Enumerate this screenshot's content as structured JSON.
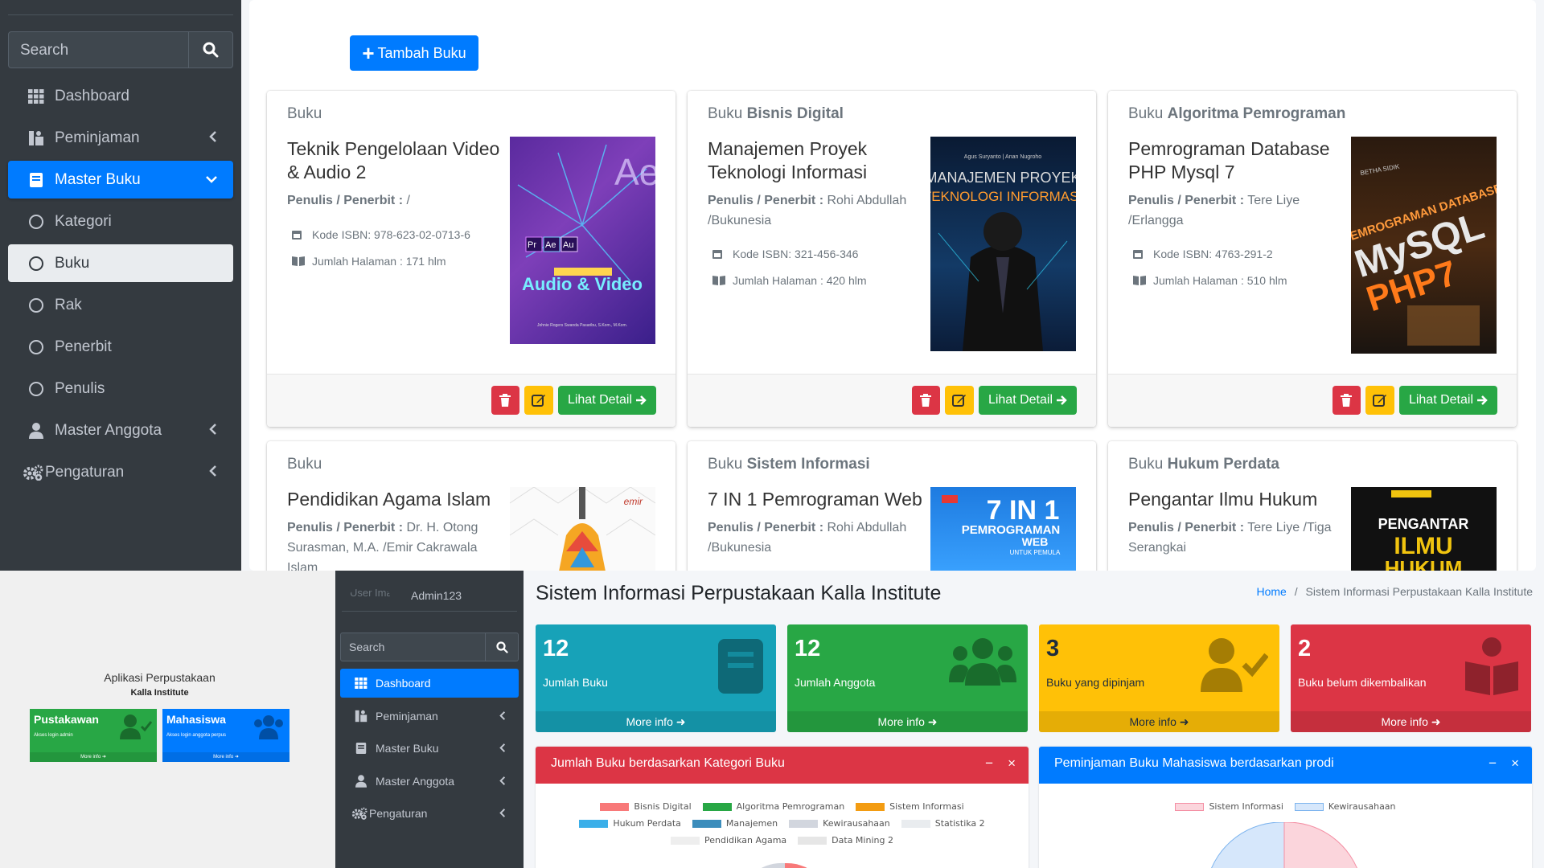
{
  "top": {
    "search_placeholder": "Search",
    "sidebar": [
      {
        "label": "Dashboard"
      },
      {
        "label": "Peminjaman"
      },
      {
        "label": "Master Buku"
      },
      {
        "label": "Kategori"
      },
      {
        "label": "Buku"
      },
      {
        "label": "Rak"
      },
      {
        "label": "Penerbit"
      },
      {
        "label": "Penulis"
      },
      {
        "label": "Master Anggota"
      },
      {
        "label": "Pengaturan"
      }
    ],
    "add_button": "Tambah Buku",
    "author_label": "Penulis / Penerbit :",
    "detail_label": "Lihat Detail",
    "cards": [
      {
        "prefix": "Buku",
        "category": "",
        "title": "Teknik Pengelolaan Video & Audio 2",
        "author": " /",
        "isbn": "Kode ISBN: 978-623-02-0713-6",
        "pages": "Jumlah Halaman : 171 hlm",
        "cover_text": "Audio & Video"
      },
      {
        "prefix": "Buku",
        "category": "Bisnis Digital",
        "title": "Manajemen Proyek Teknologi Informasi",
        "author": " Rohi Abdullah /Bukunesia",
        "isbn": "Kode ISBN: 321-456-346",
        "pages": "Jumlah Halaman : 420 hlm",
        "cover_text": "MANAJEMEN PROYEK TEKNOLOGI INFORMASI"
      },
      {
        "prefix": "Buku",
        "category": "Algoritma Pemrograman",
        "title": "Pemrograman Database PHP Mysql 7",
        "author": " Tere Liye /Erlangga",
        "isbn": "Kode ISBN: 4763-291-2",
        "pages": "Jumlah Halaman : 510 hlm",
        "cover_text": "MySQL PHP7"
      },
      {
        "prefix": "Buku",
        "category": "",
        "title": "Pendidikan Agama Islam",
        "author": " Dr. H. Otong Surasman, M.A. /Emir Cakrawala Islam",
        "cover_text": "emir"
      },
      {
        "prefix": "Buku",
        "category": "Sistem Informasi",
        "title": "7 IN 1 Pemrograman Web",
        "author": " Rohi Abdullah /Bukunesia",
        "cover_text": "7 IN 1 PEMROGRAMAN WEB"
      },
      {
        "prefix": "Buku",
        "category": "Hukum Perdata",
        "title": "Pengantar Ilmu Hukum",
        "author": " Tere Liye /Tiga Serangkai",
        "cover_text": "PENGANTAR ILMU HUKUM"
      }
    ]
  },
  "login": {
    "app_title": "Aplikasi Perpustakaan",
    "app_sub": "Kalla Institute",
    "boxes": [
      {
        "title": "Pustakawan",
        "desc": "Akses login admin",
        "more": "More info",
        "color": "#28a745"
      },
      {
        "title": "Mahasiswa",
        "desc": "Akses login anggota perpus",
        "more": "More info",
        "color": "#007bff"
      }
    ]
  },
  "dash": {
    "user_image_alt": "User Image",
    "username": "Admin123",
    "search_placeholder": "Search",
    "sidebar": [
      {
        "label": "Dashboard"
      },
      {
        "label": "Peminjaman"
      },
      {
        "label": "Master Buku"
      },
      {
        "label": "Master Anggota"
      },
      {
        "label": "Pengaturan"
      }
    ],
    "page_title": "Sistem Informasi Perpustakaan Kalla Institute",
    "breadcrumb_home": "Home",
    "breadcrumb_sep": "/",
    "breadcrumb_current": "Sistem Informasi Perpustakaan Kalla Institute",
    "stats": [
      {
        "num": "12",
        "label": "Jumlah Buku",
        "more": "More info",
        "color": "#17a2b8"
      },
      {
        "num": "12",
        "label": "Jumlah Anggota",
        "more": "More info",
        "color": "#28a745"
      },
      {
        "num": "3",
        "label": "Buku yang dipinjam",
        "more": "More info",
        "color": "#ffc107"
      },
      {
        "num": "2",
        "label": "Buku belum dikembalikan",
        "more": "More info",
        "color": "#dc3545"
      }
    ],
    "chart_boxes": [
      {
        "title": "Jumlah Buku berdasarkan Kategori Buku",
        "color": "#dc3545",
        "legend": [
          {
            "name": "Bisnis Digital",
            "color": "#f87979"
          },
          {
            "name": "Algoritma Pemrograman",
            "color": "#28a745"
          },
          {
            "name": "Sistem Informasi",
            "color": "#f39c12"
          },
          {
            "name": "Hukum Perdata",
            "color": "#3bafe9"
          },
          {
            "name": "Manajemen",
            "color": "#3c8dbc"
          },
          {
            "name": "Kewirausahaan",
            "color": "#d2d6de"
          },
          {
            "name": "Statistika 2",
            "color": "#e9ecef"
          },
          {
            "name": "Pendidikan Agama",
            "color": "#eeeeee"
          },
          {
            "name": "Data Mining 2",
            "color": "#e6e6e6"
          }
        ]
      },
      {
        "title": "Peminjaman Buku Mahasiswa berdasarkan prodi",
        "color": "#007bff",
        "legend": [
          {
            "name": "Sistem Informasi",
            "color": "#fbd5dc"
          },
          {
            "name": "Kewirausahaan",
            "color": "#d6e7fb"
          }
        ]
      }
    ]
  }
}
